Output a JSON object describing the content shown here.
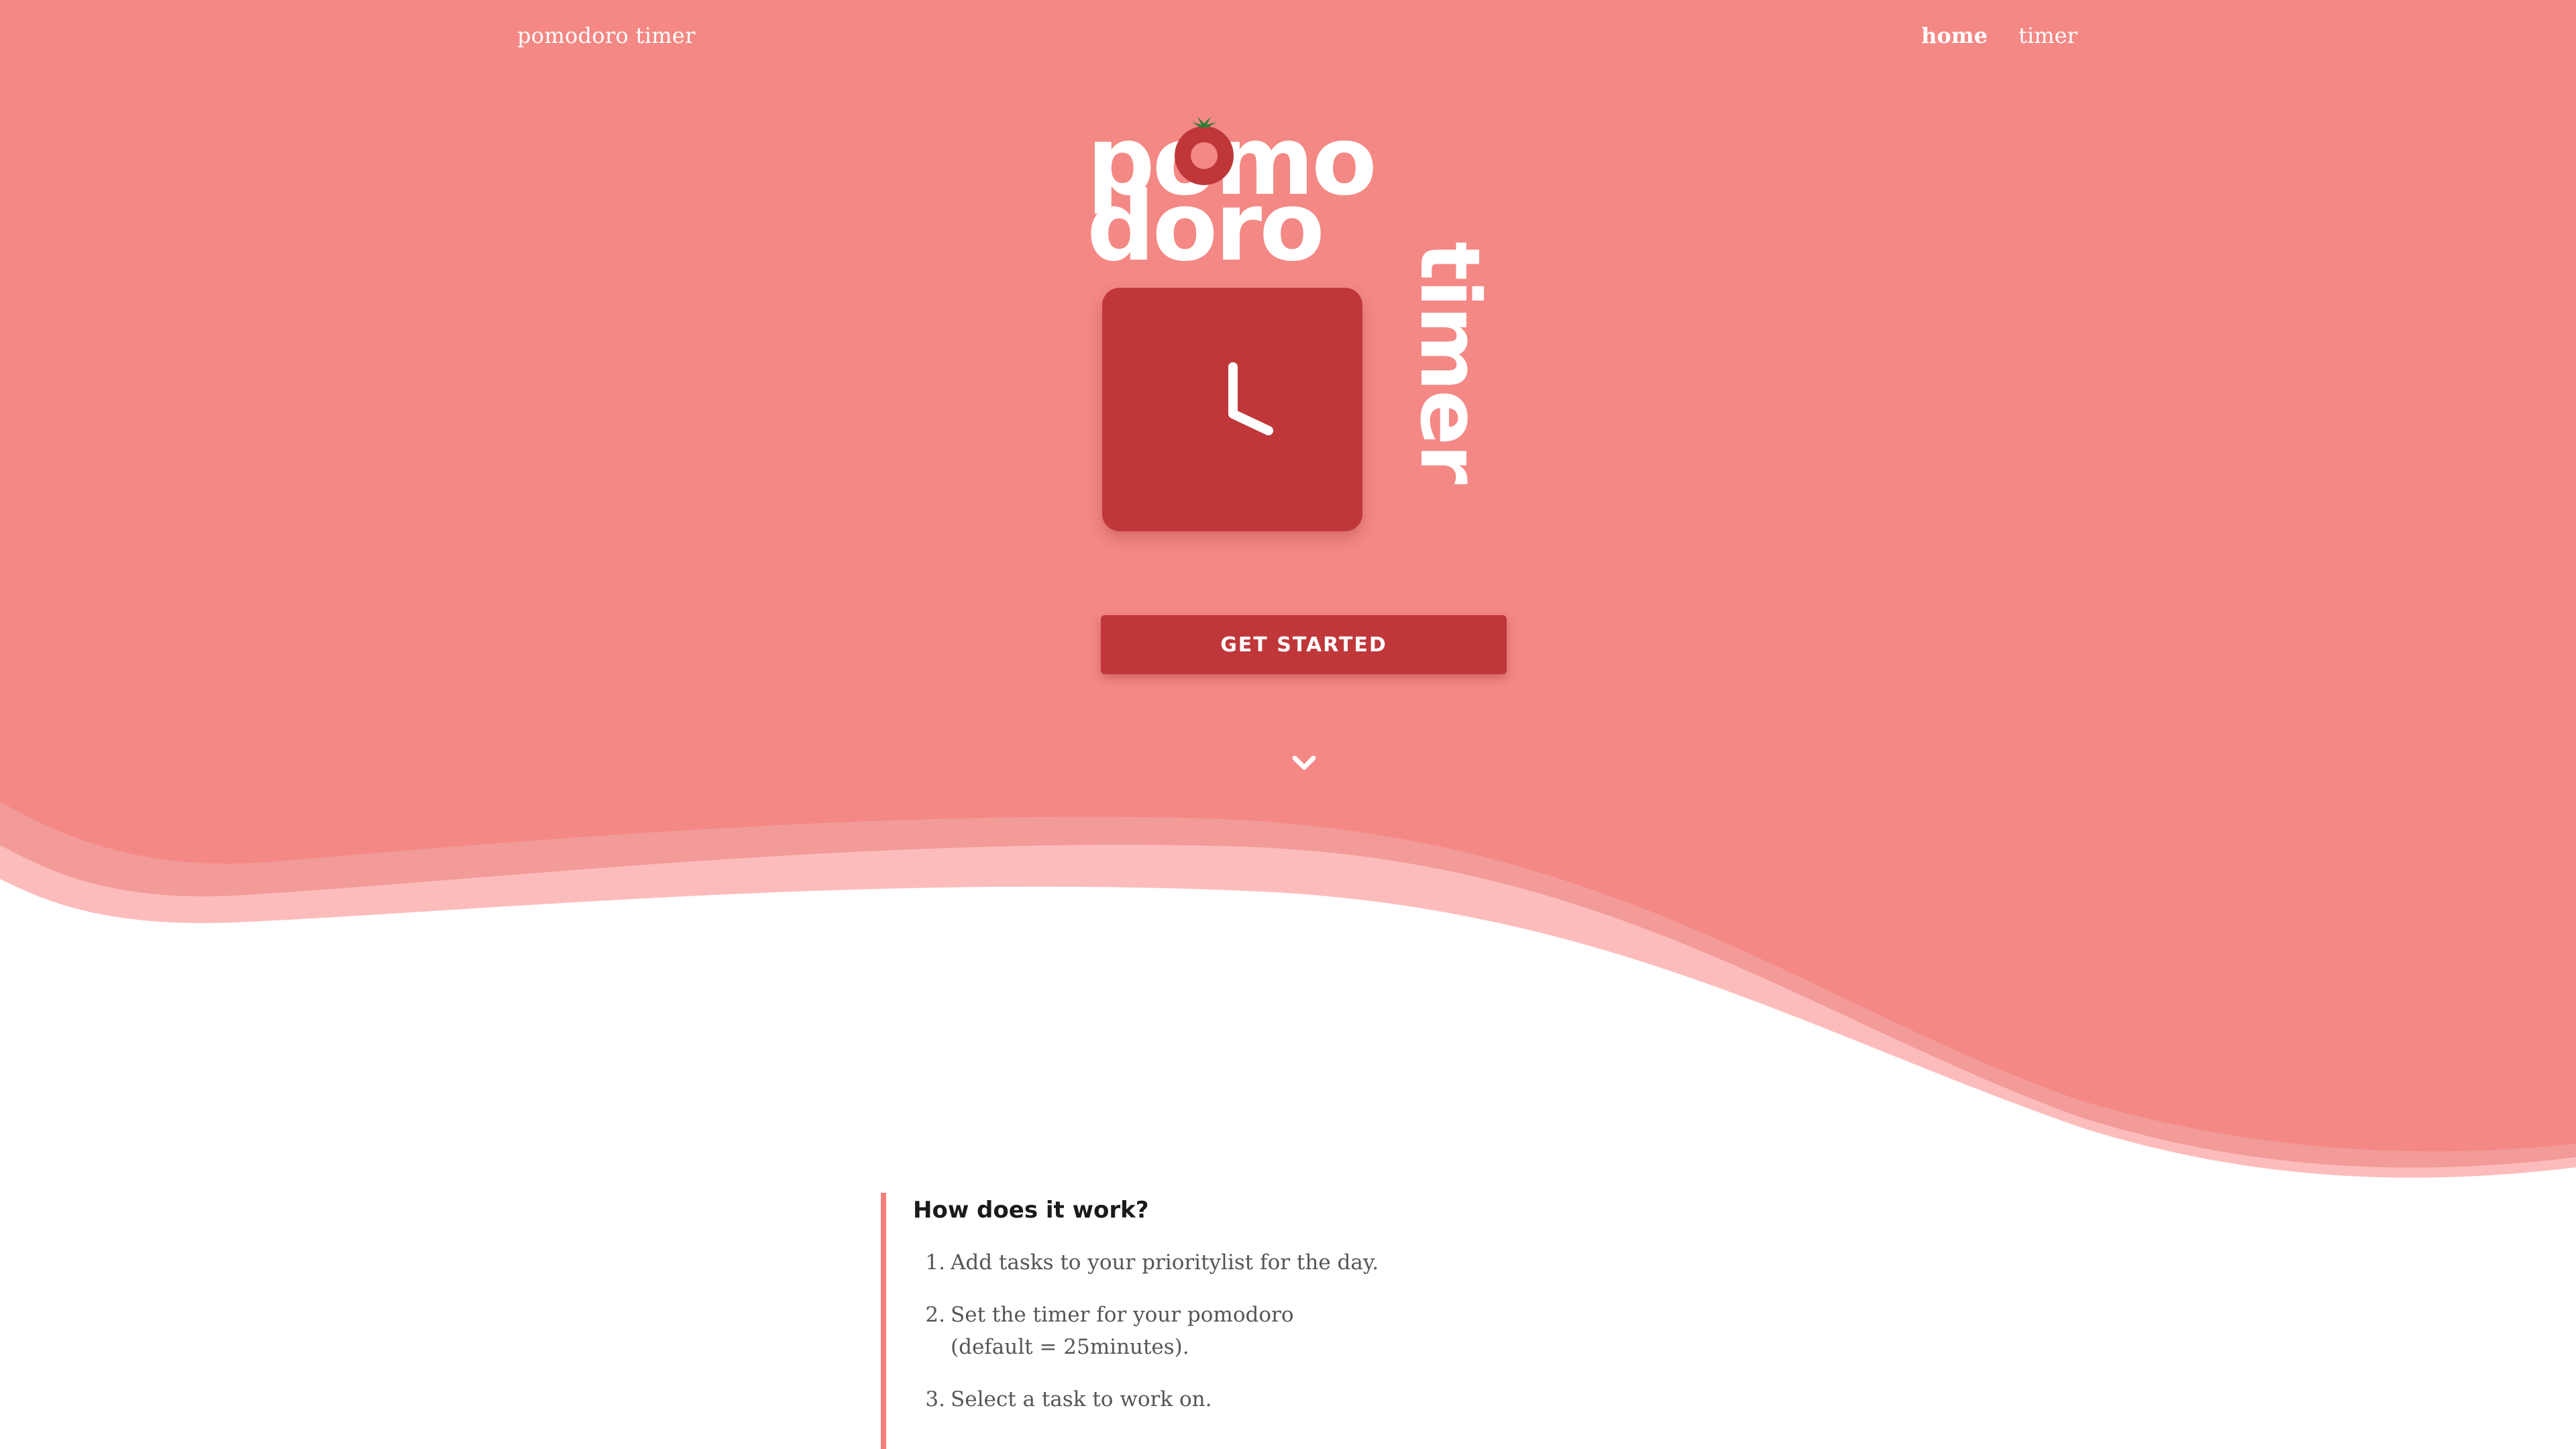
{
  "colors": {
    "hero_bg": "#f48884",
    "wave_mid": "#f29b98",
    "wave_light": "#fdbcbc",
    "accent": "#c0373a",
    "white": "#ffffff"
  },
  "header": {
    "brand": "pomodoro timer",
    "nav": [
      {
        "label": "home",
        "active": true
      },
      {
        "label": "timer",
        "active": false
      }
    ]
  },
  "logo": {
    "line1": "pomo",
    "line2": "doro",
    "vertical": "timer"
  },
  "hero": {
    "cta_label": "GET STARTED",
    "scroll_icon": "chevron-down-icon",
    "clock_icon": "clock-hands-icon"
  },
  "how_it_works": {
    "title": "How does it work?",
    "steps": [
      {
        "num": "1.",
        "text": "Add tasks to your prioritylist for the day."
      },
      {
        "num": "2.",
        "text": "Set the timer for your pomodoro\n(default = 25minutes)."
      },
      {
        "num": "3.",
        "text": "Select a task to work on."
      }
    ]
  }
}
